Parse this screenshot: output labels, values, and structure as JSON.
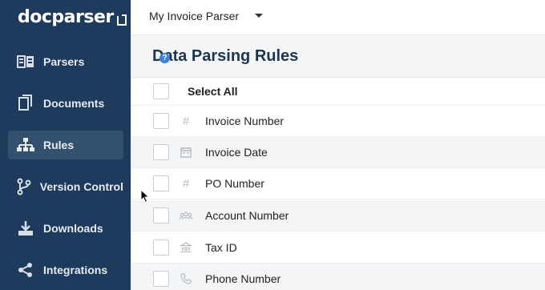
{
  "app": {
    "logo_text": "docparser"
  },
  "sidebar": {
    "items": [
      {
        "label": "Parsers",
        "icon": "parsers-icon"
      },
      {
        "label": "Documents",
        "icon": "documents-icon"
      },
      {
        "label": "Rules",
        "icon": "rules-icon",
        "active": true
      },
      {
        "label": "Version Control",
        "icon": "branch-icon"
      },
      {
        "label": "Downloads",
        "icon": "download-icon"
      },
      {
        "label": "Integrations",
        "icon": "share-icon"
      }
    ]
  },
  "topbar": {
    "parser_name": "My Invoice Parser"
  },
  "page": {
    "title": "Data Parsing Rules",
    "help": "?"
  },
  "rules": {
    "select_all_label": "Select All",
    "items": [
      {
        "label": "Invoice Number",
        "icon": "hash-icon"
      },
      {
        "label": "Invoice Date",
        "icon": "calendar-icon"
      },
      {
        "label": "PO Number",
        "icon": "hash-icon"
      },
      {
        "label": "Account Number",
        "icon": "group-icon"
      },
      {
        "label": "Tax ID",
        "icon": "bank-icon"
      },
      {
        "label": "Phone Number",
        "icon": "phone-icon"
      }
    ]
  },
  "colors": {
    "sidebar_bg": "#1e3a5c",
    "sidebar_active": "#34506f",
    "title_text": "#1e3550",
    "help_icon": "#3f7fd6"
  }
}
